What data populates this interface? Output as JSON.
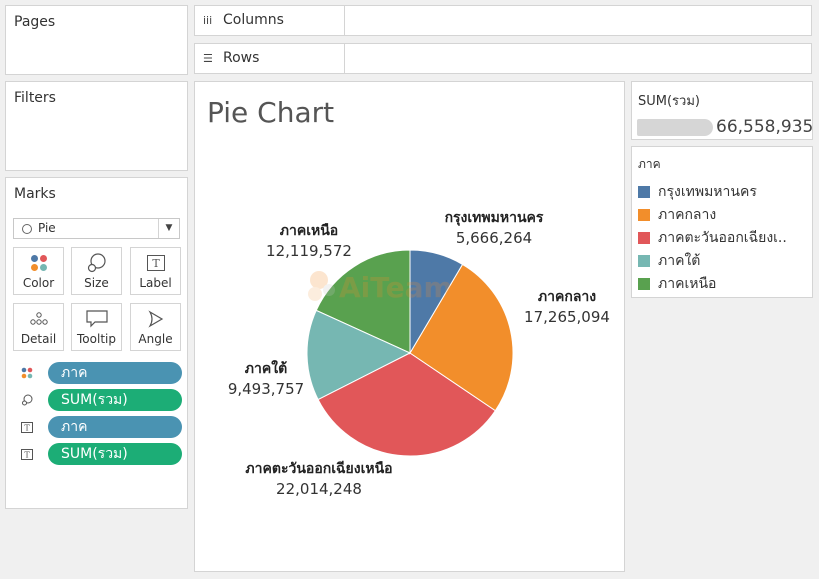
{
  "cards": {
    "pages_title": "Pages",
    "filters_title": "Filters",
    "marks_title": "Marks"
  },
  "shelves": {
    "columns_label": "Columns",
    "rows_label": "Rows"
  },
  "marks": {
    "mark_type": "Pie",
    "buttons": [
      {
        "label": "Color",
        "icon": "color-dots-icon"
      },
      {
        "label": "Size",
        "icon": "size-icon"
      },
      {
        "label": "Label",
        "icon": "label-icon"
      },
      {
        "label": "Detail",
        "icon": "detail-dots-icon"
      },
      {
        "label": "Tooltip",
        "icon": "tooltip-icon"
      },
      {
        "label": "Angle",
        "icon": "angle-icon"
      }
    ],
    "pills": [
      {
        "icon": "color-dots-icon",
        "text": "ภาค",
        "color": "#4a93b2"
      },
      {
        "icon": "size-icon",
        "text": "SUM(รวม)",
        "color": "#1cad76"
      },
      {
        "icon": "label-icon",
        "text": "ภาค",
        "color": "#4a93b2"
      },
      {
        "icon": "label-icon",
        "text": "SUM(รวม)",
        "color": "#1cad76"
      }
    ]
  },
  "sheet": {
    "title": "Pie Chart"
  },
  "size_legend": {
    "title": "SUM(รวม)",
    "max_value": "66,558,935"
  },
  "color_legend": {
    "title": "ภาค",
    "items": [
      {
        "label": "กรุงเทพมหานคร",
        "color": "#4e79a7"
      },
      {
        "label": "ภาคกลาง",
        "color": "#f28e2b"
      },
      {
        "label": "ภาคตะวันออกเฉียงเ..",
        "color": "#e15759"
      },
      {
        "label": "ภาคใต้",
        "color": "#76b7b2"
      },
      {
        "label": "ภาคเหนือ",
        "color": "#59a14f"
      }
    ]
  },
  "chart_data": {
    "type": "pie",
    "title": "Pie Chart",
    "categories": [
      "กรุงเทพมหานคร",
      "ภาคกลาง",
      "ภาคตะวันออกเฉียงเหนือ",
      "ภาคใต้",
      "ภาคเหนือ"
    ],
    "values": [
      5666264,
      17265094,
      22014248,
      9493757,
      12119572
    ],
    "value_labels": [
      "5,666,264",
      "17,265,094",
      "22,014,248",
      "9,493,757",
      "12,119,572"
    ],
    "colors": [
      "#4e79a7",
      "#f28e2b",
      "#e15759",
      "#76b7b2",
      "#59a14f"
    ],
    "legend": "right"
  }
}
